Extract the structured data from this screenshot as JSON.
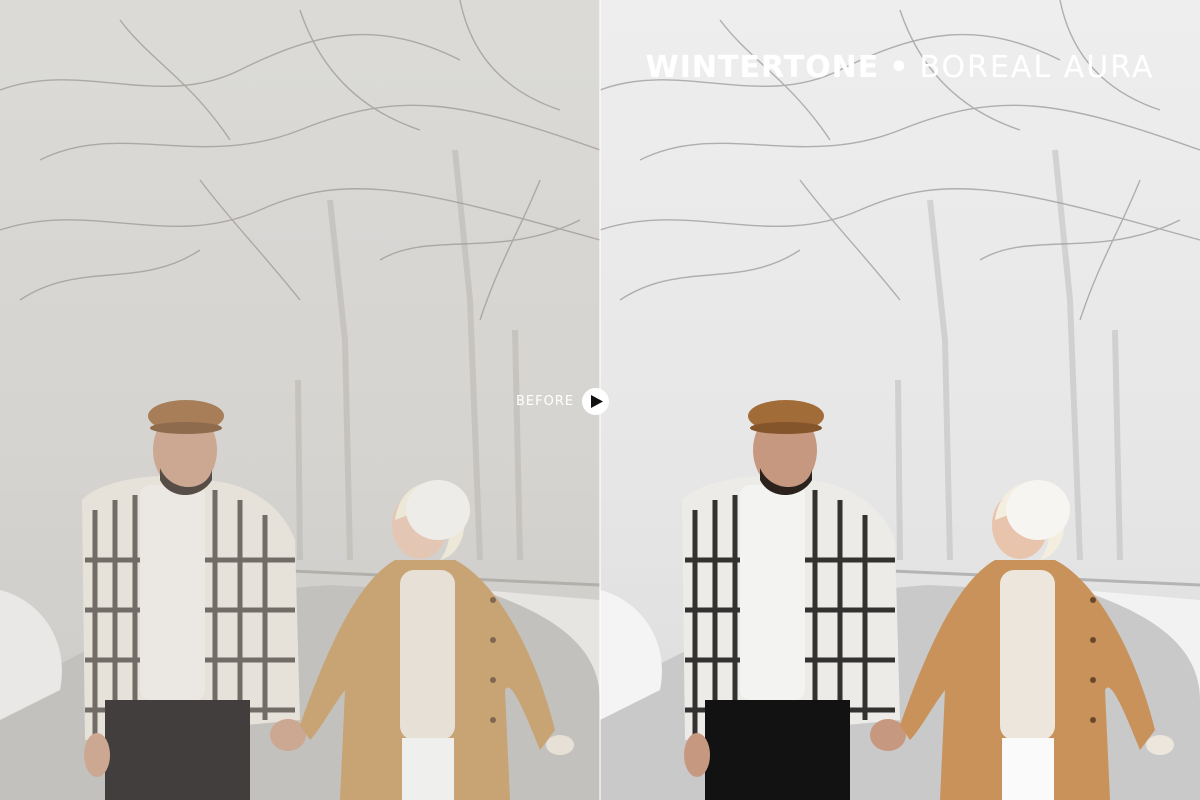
{
  "title": {
    "brand": "WINTERTONE",
    "separator": "•",
    "preset": "BOREAL AURA"
  },
  "compare": {
    "before_label": "BEFORE",
    "toggle_icon": "play-icon"
  },
  "colors": {
    "text": "#ffffff",
    "before_fog": "#d6d4d1",
    "after_fog": "#ebebeb",
    "coat": "#c4965f",
    "cap": "#9b6a3c"
  }
}
